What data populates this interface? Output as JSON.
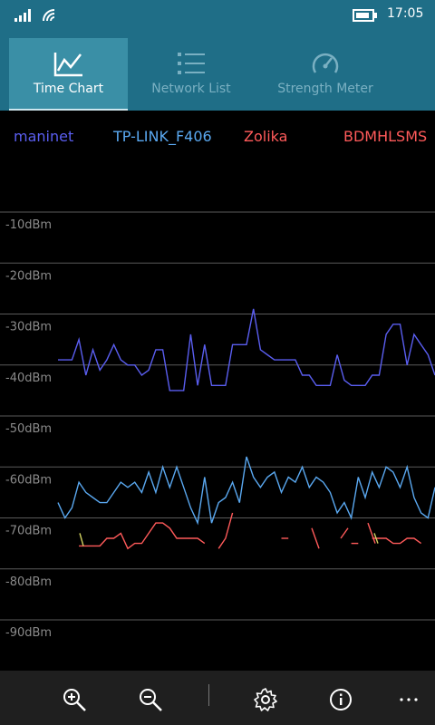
{
  "status": {
    "time": "17:05",
    "signal_icon": "signal-bars-icon",
    "wifi_icon": "wifi-icon",
    "battery_icon": "battery-icon"
  },
  "tabs": [
    {
      "label": "Time Chart",
      "icon": "line-chart-icon",
      "active": true
    },
    {
      "label": "Network List",
      "icon": "list-icon",
      "active": false
    },
    {
      "label": "Strength Meter",
      "icon": "gauge-icon",
      "active": false
    }
  ],
  "legend": [
    {
      "name": "maninet",
      "color": "#5a5ef0"
    },
    {
      "name": "TP-LINK_F406",
      "color": "#5aa8f0"
    },
    {
      "name": "Zolika",
      "color": "#ff5a5a"
    },
    {
      "name": "BDMHLSMS",
      "color": "#ff5a5a"
    }
  ],
  "chart_data": {
    "type": "line",
    "ylabel_unit": "dBm",
    "yticks": [
      "-10dBm",
      "-20dBm",
      "-30dBm",
      "-40dBm",
      "-50dBm",
      "-60dBm",
      "-70dBm",
      "-80dBm",
      "-90dBm"
    ],
    "ylim": [
      -100,
      0
    ],
    "grid": true,
    "series": [
      {
        "name": "maninet",
        "color": "#5a5ef0",
        "values": [
          -39,
          -39,
          -39,
          -35,
          -42,
          -37,
          -41,
          -39,
          -36,
          -39,
          -40,
          -40,
          -42,
          -41,
          -37,
          -37,
          -45,
          -45,
          -45,
          -34,
          -44,
          -36,
          -44,
          -44,
          -44,
          -36,
          -36,
          -36,
          -29,
          -37,
          -38,
          -39,
          -39,
          -39,
          -39,
          -42,
          -42,
          -44,
          -44,
          -44,
          -38,
          -43,
          -44,
          -44,
          -44,
          -42,
          -42,
          -34,
          -32,
          -32,
          -40,
          -34,
          -36,
          -38,
          -42
        ]
      },
      {
        "name": "TP-LINK_F406",
        "color": "#5aa8f0",
        "values": [
          -67,
          -70,
          -68,
          -63,
          -65,
          -66,
          -67,
          -67,
          -65,
          -63,
          -64,
          -63,
          -65,
          -61,
          -65,
          -60,
          -64,
          -60,
          -64,
          -68,
          -71,
          -62,
          -71,
          -67,
          -66,
          -63,
          -67,
          -58,
          -62,
          -64,
          -62,
          -61,
          -65,
          -62,
          -63,
          -60,
          -64,
          -62,
          -63,
          -65,
          -69,
          -67,
          -70,
          -62,
          -66,
          -61,
          -64,
          -60,
          -61,
          -64,
          -60,
          -66,
          -69,
          -70,
          -64
        ]
      },
      {
        "name": "Zolika",
        "color": "#ff5a5a",
        "values": [
          null,
          null,
          null,
          -75.5,
          -75.5,
          -75.5,
          -75.5,
          -74,
          -74,
          -73,
          -76,
          -75,
          -75,
          -73,
          -71,
          -71,
          -72,
          -74,
          -74,
          -74,
          -74,
          -75,
          null,
          -76,
          -74,
          -69,
          null,
          null,
          null,
          null,
          null,
          null,
          -74,
          -74,
          null,
          null,
          null,
          -73,
          null,
          null,
          null,
          null,
          -75,
          -75,
          null,
          -74,
          -74,
          -74,
          -75,
          -75,
          -74,
          -74,
          -75,
          null,
          null
        ]
      }
    ],
    "segments_outside_series": [
      {
        "color": "#d0d060",
        "from": [
          9,
          -73
        ],
        "to": [
          11,
          -75.5
        ]
      },
      {
        "color": "#d0d060",
        "from": [
          413,
          -73
        ],
        "to": [
          417,
          -75
        ]
      },
      {
        "color": "#ff5a5a",
        "from": [
          344,
          -72
        ],
        "to": [
          352,
          -76
        ]
      },
      {
        "color": "#ff5a5a",
        "from": [
          376,
          -74
        ],
        "to": [
          384,
          -72
        ]
      },
      {
        "color": "#ff5a5a",
        "from": [
          406,
          -71
        ],
        "to": [
          414,
          -75
        ]
      }
    ]
  },
  "appbar": {
    "buttons": [
      {
        "name": "zoom-in-button",
        "icon": "zoom-in-icon"
      },
      {
        "name": "zoom-out-button",
        "icon": "zoom-out-icon"
      },
      {
        "name": "settings-button",
        "icon": "gear-icon"
      },
      {
        "name": "info-button",
        "icon": "info-icon"
      },
      {
        "name": "more-button",
        "icon": "more-icon"
      }
    ]
  }
}
